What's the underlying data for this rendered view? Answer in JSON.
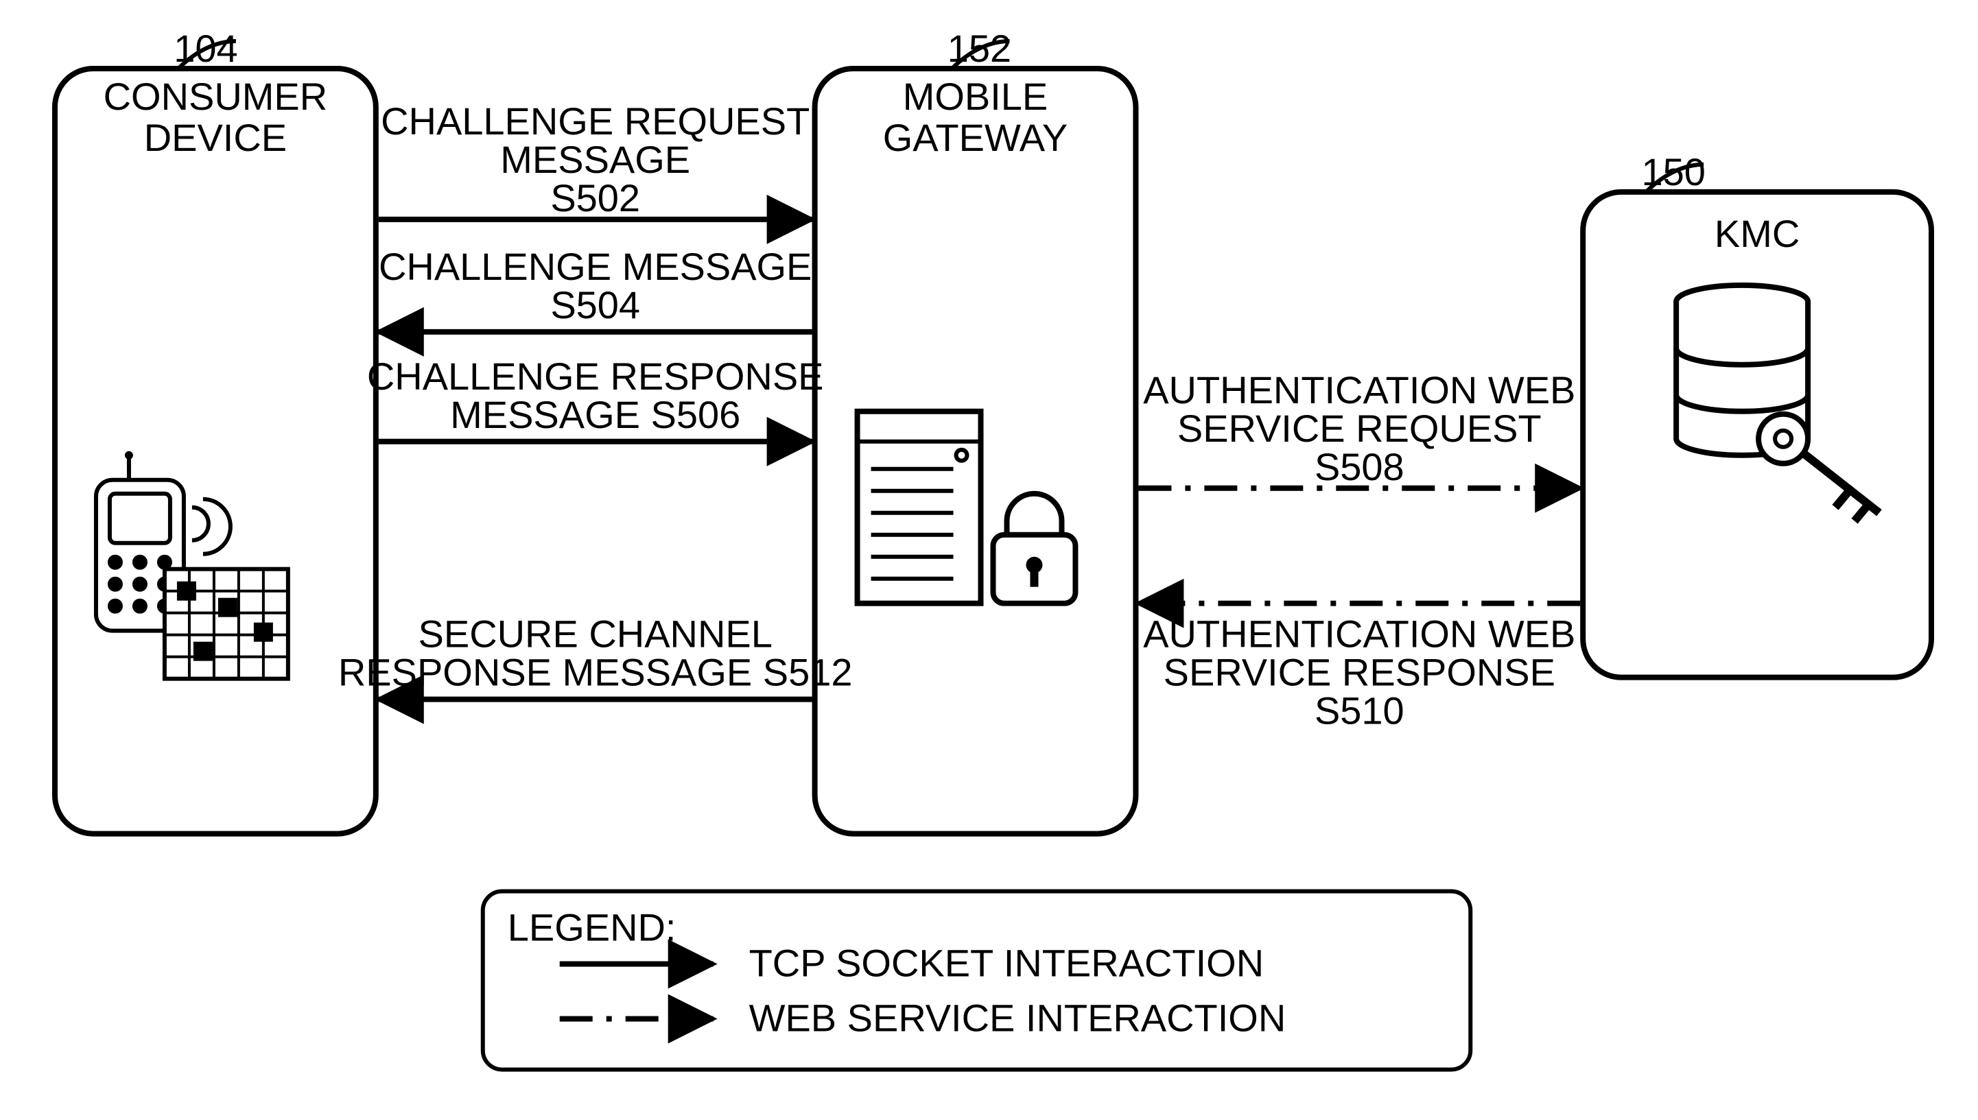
{
  "refs": {
    "consumer": "104",
    "gateway": "152",
    "kmc": "150"
  },
  "boxes": {
    "consumer": {
      "l1": "CONSUMER",
      "l2": "DEVICE"
    },
    "gateway": {
      "l1": "MOBILE",
      "l2": "GATEWAY"
    },
    "kmc": {
      "l1": "KMC"
    }
  },
  "msgs": {
    "s502": {
      "l1": "CHALLENGE REQUEST",
      "l2": "MESSAGE",
      "l3": "S502"
    },
    "s504": {
      "l1": "CHALLENGE MESSAGE",
      "l2": "S504"
    },
    "s506": {
      "l1": "CHALLENGE RESPONSE",
      "l2": "MESSAGE S506"
    },
    "s508": {
      "l1": "AUTHENTICATION WEB",
      "l2": "SERVICE REQUEST",
      "l3": "S508"
    },
    "s510": {
      "l1": "AUTHENTICATION WEB",
      "l2": "SERVICE RESPONSE",
      "l3": "S510"
    },
    "s512": {
      "l1": "SECURE CHANNEL",
      "l2": "RESPONSE MESSAGE S512"
    }
  },
  "legend": {
    "title": "LEGEND:",
    "tcp": "TCP SOCKET INTERACTION",
    "web": "WEB SERVICE INTERACTION"
  }
}
